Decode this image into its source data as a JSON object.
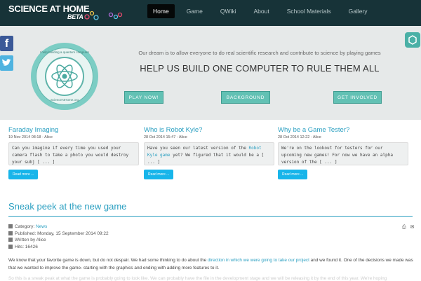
{
  "brand": {
    "name": "SCIENCE AT HOME",
    "beta": "BETA"
  },
  "nav": [
    {
      "label": "Home",
      "active": true
    },
    {
      "label": "Game"
    },
    {
      "label": "QWiki"
    },
    {
      "label": "About"
    },
    {
      "label": "School Materials"
    },
    {
      "label": "Gallery"
    }
  ],
  "hero": {
    "badge_top": "I help building a quantum computer",
    "badge_bottom": "ScienceAtHome.org",
    "tagline": "Our dream is to allow everyone to do real scientific research and contribute to science by playing games",
    "title": "HELP US BUILD ONE COMPUTER TO RULE THEM ALL",
    "buttons": [
      "PLAY NOW!",
      "BACKGROUND",
      "GET INVOLVED"
    ]
  },
  "articles": [
    {
      "title": "Faraday Imaging",
      "date": "19 Nov 2014 08:18 - Alice",
      "excerpt": "Can you imagine if every time you used your camera flash to take a photo you would destroy your subj [ ... ]",
      "read_more": "Read more ..."
    },
    {
      "title": "Who is Robot Kyle?",
      "date": "28 Oct 2014 15:47 - Alice",
      "excerpt_pre": "Have you seen our latest version of the ",
      "excerpt_link": "Robot Kyle game",
      "excerpt_post": " yet? We figured that it would be a [ ... ]",
      "read_more": "Read more ..."
    },
    {
      "title": "Why be a Game Tester?",
      "date": "28 Oct 2014 12:22 - Alice",
      "excerpt": "We're on the lookout for testers for our upcoming new games! For now we have an alpha version of the [ ... ]",
      "read_more": "Read more ..."
    }
  ],
  "post": {
    "title": "Sneak peek at the new game",
    "category_label": "Category:",
    "category": "News",
    "published": "Published: Monday, 15 September 2014 09:22",
    "written_by": "Written by Alice",
    "hits": "Hits: 16426",
    "body_1": "We know that your favorite game is down, but do not despair. We had some thinking to do about the ",
    "body_link": "direction in which we were going to take our project",
    "body_2": " and we found  it. One of the decisions we made was that we wanted to improve the game- starting with the graphics and ending with adding more features to it.",
    "body_cut": "So this is a sneak peak at what the game is probably going to look like. We can probably have the file in the development stage and we will be releasing it by the end of this year. We're hoping"
  },
  "colors": {
    "nav_bg": "#173338",
    "accent": "#2a9fc1",
    "hero_btn": "#62c1b4",
    "read_more": "#18b5ea"
  }
}
